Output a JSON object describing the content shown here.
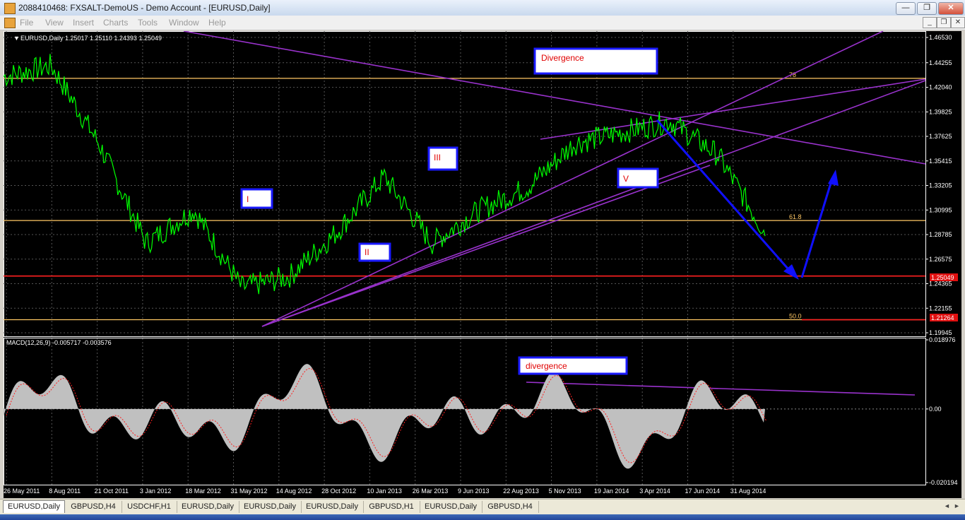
{
  "window": {
    "title": "2088410468: FXSALT-DemoUS - Demo Account - [EURUSD,Daily]",
    "minimize": "—",
    "restore": "❐",
    "close": "✕"
  },
  "menu": {
    "items": [
      "File",
      "View",
      "Insert",
      "Charts",
      "Tools",
      "Window",
      "Help"
    ],
    "mdi": {
      "minimize": "_",
      "restore": "❐",
      "close": "✕"
    }
  },
  "colors": {
    "chart_bg": "#000000",
    "price": "#00ff00",
    "trendline": "#9932cc",
    "fib": "#ffc864",
    "support": "#ff2020",
    "arrow": "#1010ff",
    "macd_hist": "#c0c0c0",
    "macd_signal": "#ff2020",
    "label_text": "#e00000",
    "axis_text": "#ffffff"
  },
  "chart_data": [
    {
      "type": "line",
      "title": "EURUSD,Daily  1.25017 1.25110 1.24393 1.25049",
      "y_ticks": [
        "1.46530",
        "1.44255",
        "1.42040",
        "1.39825",
        "1.37625",
        "1.35415",
        "1.33205",
        "1.30995",
        "1.28785",
        "1.26575",
        "1.24365",
        "1.22155",
        "1.19945"
      ],
      "ylim": [
        1.19945,
        1.4653
      ],
      "x_ticks": [
        "26 May 2011",
        "8 Aug 2011",
        "21 Oct 2011",
        "3 Jan 2012",
        "18 Mar 2012",
        "31 May 2012",
        "14 Aug 2012",
        "28 Oct 2012",
        "10 Jan 2013",
        "26 Mar 2013",
        "9 Jun 2013",
        "22 Aug 2013",
        "5 Nov 2013",
        "19 Jan 2014",
        "3 Apr 2014",
        "17 Jun 2014",
        "31 Aug 2014"
      ],
      "x": [
        "26 May 2011",
        "8 Aug 2011",
        "21 Oct 2011",
        "3 Jan 2012",
        "18 Mar 2012",
        "31 May 2012",
        "14 Aug 2012",
        "28 Oct 2012",
        "10 Jan 2013",
        "26 Mar 2013",
        "9 Jun 2013",
        "22 Aug 2013",
        "5 Nov 2013",
        "19 Jan 2014",
        "3 Apr 2014",
        "17 Jun 2014",
        "31 Aug 2014"
      ],
      "series": [
        {
          "values": [
            1.43,
            1.44,
            1.37,
            1.28,
            1.31,
            1.24,
            1.25,
            1.29,
            1.34,
            1.28,
            1.31,
            1.33,
            1.37,
            1.38,
            1.39,
            1.36,
            1.29
          ]
        }
      ],
      "price_labels": {
        "current": "1.25049",
        "support": "1.21264"
      },
      "fib_levels": [
        {
          "label": "78",
          "value": 1.4285
        },
        {
          "label": "61.8",
          "value": 1.3005
        },
        {
          "label": "50.0",
          "value": 1.2112
        }
      ],
      "support_lines": [
        {
          "value": 1.2505
        },
        {
          "value": 1.2112
        }
      ],
      "annotations": [
        "Divergence",
        "I",
        "II",
        "III",
        "V"
      ]
    },
    {
      "type": "bar",
      "title": "MACD(12,26,9) -0.005717 -0.003576",
      "y_ticks": [
        "0.018976",
        "0.00",
        "-0.020194"
      ],
      "ylim": [
        -0.020194,
        0.018976
      ],
      "annotations": [
        "divergence"
      ]
    }
  ],
  "tabs": [
    "EURUSD,Daily",
    "GBPUSD,H4",
    "USDCHF,H1",
    "EURUSD,Daily",
    "EURUSD,Daily",
    "EURUSD,Daily",
    "GBPUSD,H1",
    "EURUSD,Daily",
    "GBPUSD,H4"
  ],
  "tab_arrows": {
    "left": "◄",
    "right": "►"
  }
}
